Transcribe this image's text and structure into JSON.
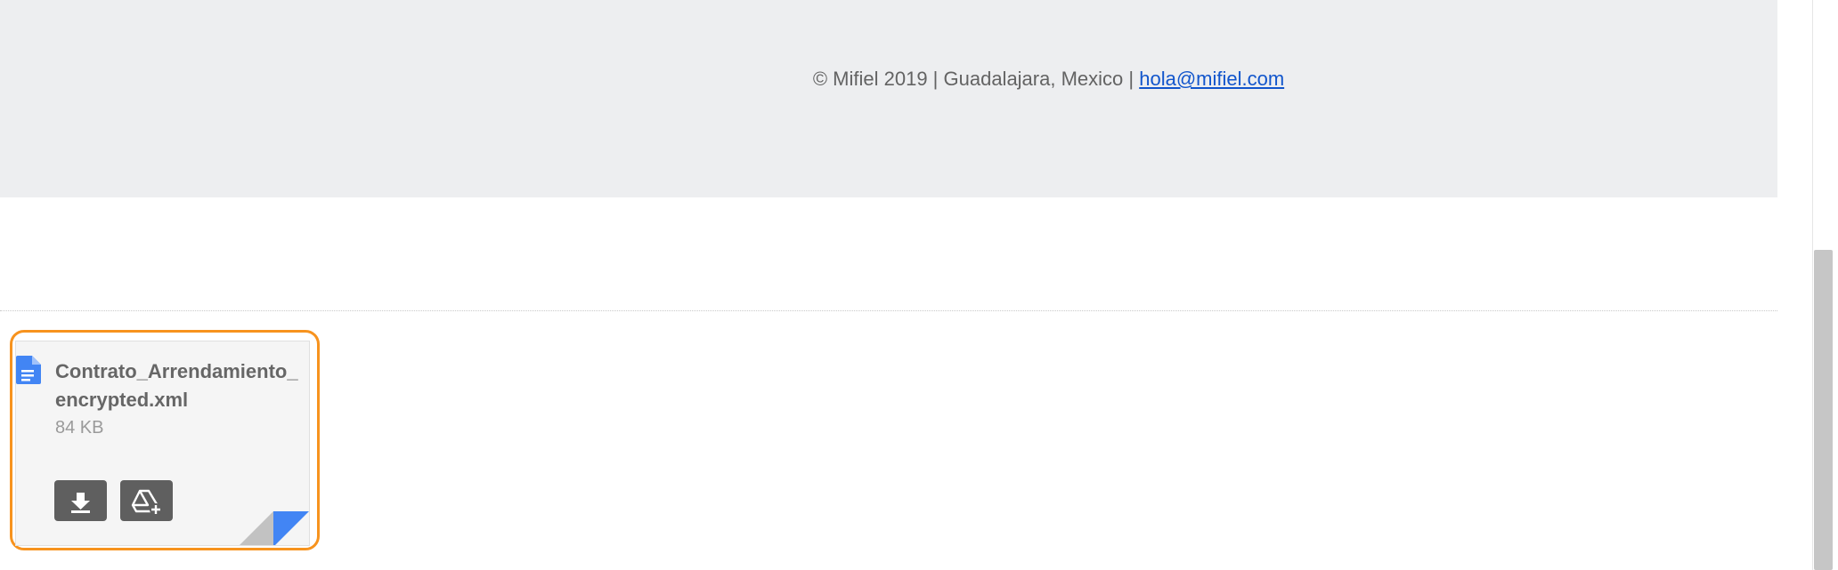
{
  "footer": {
    "copyright_text": "© Mifiel 2019 | Guadalajara, Mexico | ",
    "email_link": "hola@mifiel.com"
  },
  "attachment": {
    "file_name": "Contrato_Arrendamiento_encrypted.xml",
    "file_size": "84 KB",
    "icon": "document-icon",
    "actions": [
      {
        "name": "download",
        "icon": "download-icon"
      },
      {
        "name": "save-to-drive",
        "icon": "drive-add-icon"
      }
    ]
  },
  "colors": {
    "highlight": "#f7931e",
    "doc_icon": "#4285f4",
    "link": "#1155cc",
    "footer_bg": "#edeef0",
    "button_bg": "#5f5f5f"
  }
}
